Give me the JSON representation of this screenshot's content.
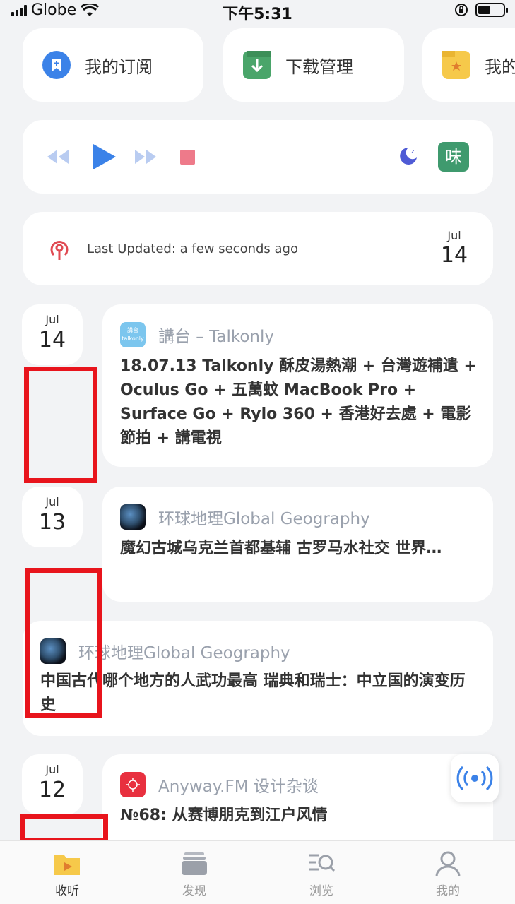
{
  "status_bar": {
    "carrier": "Globe",
    "time": "下午5:31"
  },
  "quick_actions": [
    {
      "label": "我的订阅",
      "icon": "bookmark-plus-icon"
    },
    {
      "label": "下载管理",
      "icon": "download-icon"
    },
    {
      "label": "我的",
      "icon": "star-folder-icon"
    }
  ],
  "player": {
    "avatar_char": "味"
  },
  "update_card": {
    "text": "Last Updated: a few seconds ago",
    "month": "Jul",
    "day": "14"
  },
  "feed": [
    {
      "month": "Jul",
      "day": "14",
      "source": "講台 – Talkonly",
      "logo_text": "講台\ntalkonly",
      "title": "18.07.13 Talkonly 酥皮湯熱潮 + 台灣遊補遺 + Oculus Go + 五萬蚊 MacBook Pro + Surface Go + Rylo 360 + 香港好去處 + 電影節拍 + 講電視"
    },
    {
      "month": "Jul",
      "day": "13",
      "source": "环球地理Global Geography",
      "title": "魔幻古城乌克兰首都基辅 古罗马水社交 世界…"
    },
    {
      "source": "环球地理Global Geography",
      "title": "中国古代哪个地方的人武功最高 瑞典和瑞士：中立国的演变历史"
    },
    {
      "month": "Jul",
      "day": "12",
      "source": "Anyway.FM 设计杂谈",
      "title": "№68: 从赛博朋克到江户风情"
    }
  ],
  "tabs": [
    {
      "label": "收听",
      "icon": "folder-play-icon",
      "active": true
    },
    {
      "label": "发现",
      "icon": "stack-icon",
      "active": false
    },
    {
      "label": "浏览",
      "icon": "browse-search-icon",
      "active": false
    },
    {
      "label": "我的",
      "icon": "person-icon",
      "active": false
    }
  ],
  "colors": {
    "accent_blue": "#3b82e8",
    "stop_red": "#ee7a8a",
    "avatar_green": "#3f9a6e",
    "highlight_red": "#e8141c"
  }
}
